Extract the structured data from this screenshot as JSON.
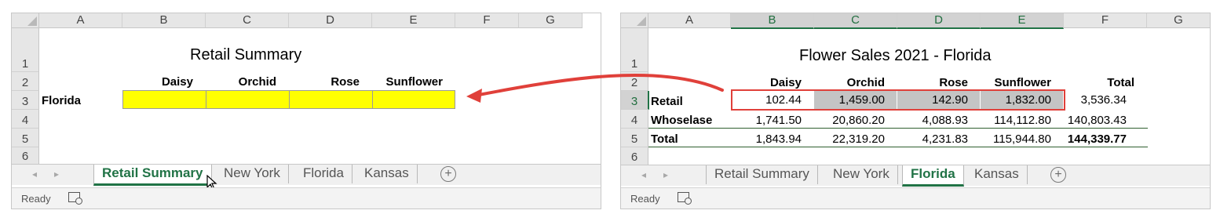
{
  "colors": {
    "excel_green": "#217346",
    "fill_yellow": "#ffff00",
    "arrow_red": "#e0403a"
  },
  "left_workbook": {
    "columns": [
      "A",
      "B",
      "C",
      "D",
      "E",
      "F",
      "G"
    ],
    "rows": [
      "1",
      "2",
      "3",
      "4",
      "5",
      "6"
    ],
    "title": "Retail Summary",
    "headers": [
      "Daisy",
      "Orchid",
      "Rose",
      "Sunflower"
    ],
    "row_label": "Florida",
    "tabs": [
      "Retail Summary",
      "New York",
      "Florida",
      "Kansas"
    ],
    "active_tab": "Retail Summary",
    "status": "Ready"
  },
  "right_workbook": {
    "columns": [
      "A",
      "B",
      "C",
      "D",
      "E",
      "F",
      "G"
    ],
    "rows": [
      "1",
      "2",
      "3",
      "4",
      "5",
      "6"
    ],
    "title": "Flower Sales 2021 - Florida",
    "headers": [
      "Daisy",
      "Orchid",
      "Rose",
      "Sunflower",
      "Total"
    ],
    "table": [
      {
        "label": "Retail",
        "values": [
          "102.44",
          "1,459.00",
          "142.90",
          "1,832.00",
          "3,536.34"
        ]
      },
      {
        "label": "Whoselase",
        "values": [
          "1,741.50",
          "20,860.20",
          "4,088.93",
          "114,112.80",
          "140,803.43"
        ]
      },
      {
        "label": "Total",
        "values": [
          "1,843.94",
          "22,319.20",
          "4,231.83",
          "115,944.80",
          "144,339.77"
        ]
      }
    ],
    "tabs": [
      "Retail Summary",
      "New York",
      "Florida",
      "Kansas"
    ],
    "active_tab": "Florida",
    "status": "Ready"
  },
  "icons": {
    "add_sheet": "+",
    "nav_prev": "◂",
    "nav_next": "▸"
  }
}
